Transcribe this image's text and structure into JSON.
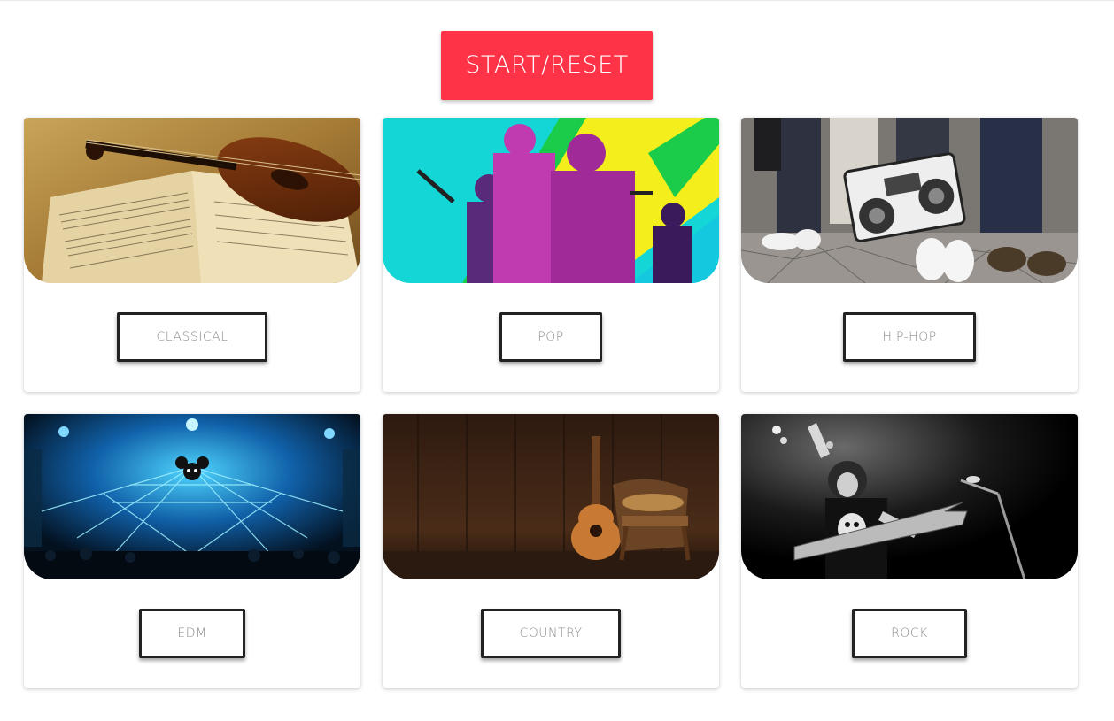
{
  "header": {
    "start_reset_label": "START/RESET",
    "button_color": "#ff3347"
  },
  "genres": [
    {
      "label": "CLASSICAL",
      "image": "violin-sheet-music-image"
    },
    {
      "label": "POP",
      "image": "pop-singers-collage-image"
    },
    {
      "label": "HIP-HOP",
      "image": "boombox-sneakers-image"
    },
    {
      "label": "EDM",
      "image": "dj-laser-stage-image"
    },
    {
      "label": "COUNTRY",
      "image": "guitar-wooden-chair-image"
    },
    {
      "label": "ROCK",
      "image": "rock-guitarist-image"
    }
  ]
}
